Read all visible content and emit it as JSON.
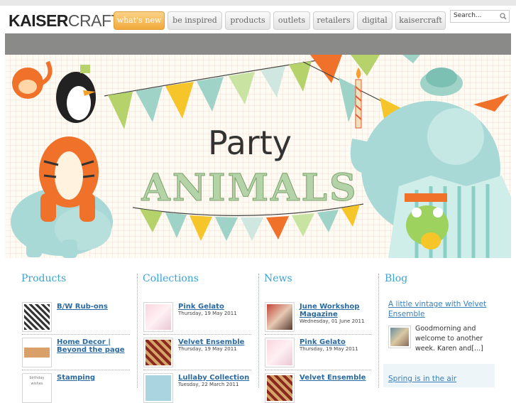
{
  "brand": {
    "part1": "KAISER",
    "part2": "CRAFT"
  },
  "nav": [
    {
      "label": "what's new",
      "active": true
    },
    {
      "label": "be inspired",
      "active": false
    },
    {
      "label": "products",
      "active": false
    },
    {
      "label": "outlets",
      "active": false
    },
    {
      "label": "retailers",
      "active": false
    },
    {
      "label": "digital",
      "active": false
    },
    {
      "label": "kaisercraft",
      "active": false
    }
  ],
  "search": {
    "placeholder": "Search...",
    "icon": "magnifier-icon"
  },
  "banner": {
    "line1": "Party",
    "line2": "ANIMALS"
  },
  "products": {
    "title": "Products",
    "items": [
      {
        "title": "B/W Rub-ons"
      },
      {
        "title": "Home Decor | Beyond the page"
      },
      {
        "title": "Stamping",
        "thumb_text": "birthday wishes"
      }
    ]
  },
  "collections": {
    "title": "Collections",
    "items": [
      {
        "title": "Pink Gelato",
        "date": "Thursday, 19 May 2011"
      },
      {
        "title": "Velvet Ensemble",
        "date": "Thursday, 19 May 2011"
      },
      {
        "title": "Lullaby Collection",
        "date": "Tuesday, 22 March 2011"
      }
    ]
  },
  "news": {
    "title": "News",
    "items": [
      {
        "title": "June Workshop Magazine",
        "date": "Wednesday, 01 June 2011"
      },
      {
        "title": "Pink Gelato",
        "date": "Thursday, 19 May 2011"
      },
      {
        "title": "Velvet Ensemble",
        "date": "Thursday, 19 May 2011"
      }
    ]
  },
  "blog": {
    "title": "Blog",
    "posts": [
      {
        "title": "A little vintage with Velvet Ensemble",
        "excerpt": "Goodmorning and welcome to another week. Karen and[...]"
      },
      {
        "title": "Spring is in the air"
      }
    ]
  },
  "colors": {
    "accent_orange": "#f2a93a",
    "link_blue": "#2a6aa0",
    "heading_blue": "#3aa3d6"
  }
}
